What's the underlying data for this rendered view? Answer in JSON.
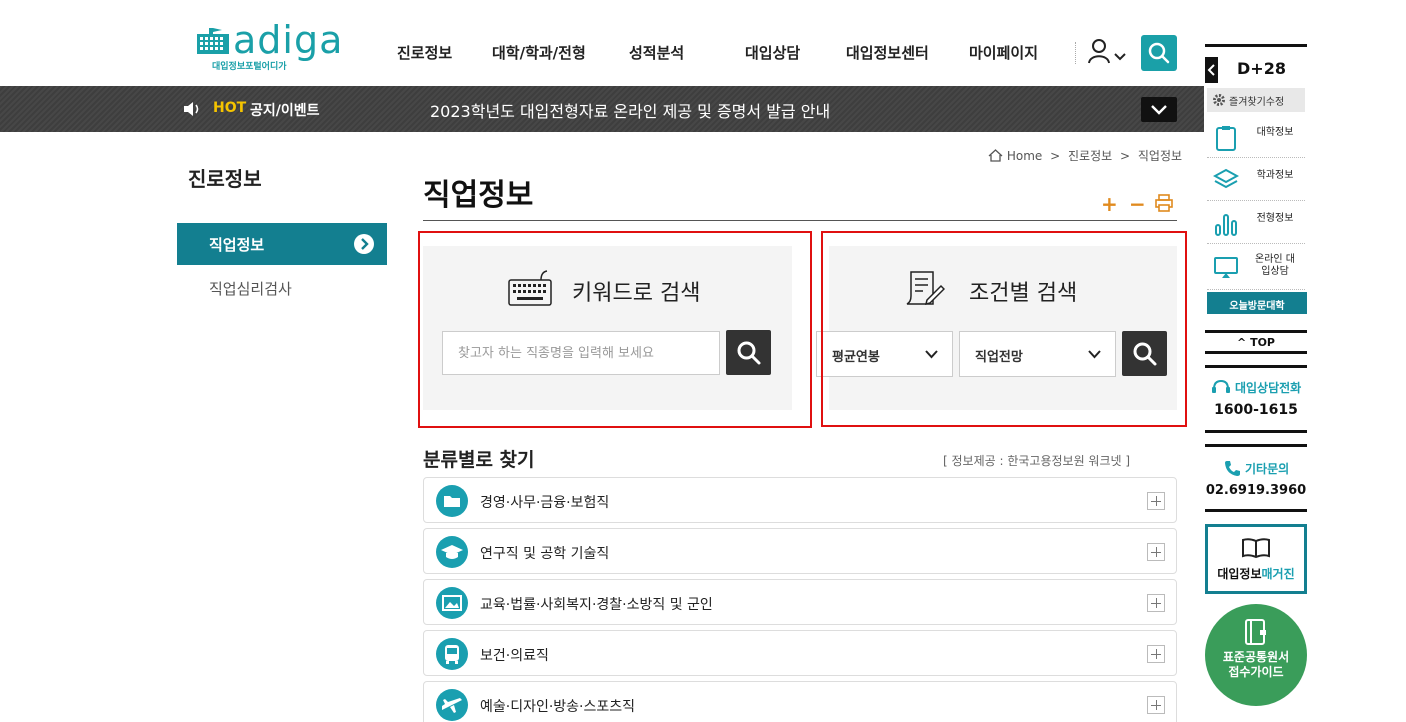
{
  "header": {
    "logo_text": "adiga",
    "logo_sub": "대입정보포털어디가",
    "nav": [
      "진로정보",
      "대학/학과/전형",
      "성적분석",
      "대입상담",
      "대입정보센터",
      "마이페이지"
    ]
  },
  "hotbar": {
    "hot_label": "HOT",
    "title": "공지/이벤트",
    "notice": "2023학년도 대입전형자료 온라인 제공 및 증명서 발급 안내"
  },
  "sidebar": {
    "title": "진로정보",
    "items": [
      "직업정보",
      "직업심리검사"
    ]
  },
  "breadcrumb": {
    "home": "Home",
    "sep": ">",
    "level1": "진로정보",
    "level2": "직업정보"
  },
  "main": {
    "title": "직업정보",
    "tools": {
      "plus": "+",
      "minus": "−"
    },
    "keyword_search": {
      "heading": "키워드로 검색",
      "placeholder": "찾고자 하는 직종명을 입력해 보세요"
    },
    "condition_search": {
      "heading": "조건별 검색",
      "select1": "평균연봉",
      "select2": "직업전망"
    },
    "category_title": "분류별로 찾기",
    "provider": "[ 정보제공 : 한국고용정보원 워크넷 ]",
    "categories": [
      "경영·사무·금융·보험직",
      "연구직 및 공학 기술직",
      "교육·법률·사회복지·경찰·소방직 및 군인",
      "보건·의료직",
      "예술·디자인·방송·스포츠직"
    ]
  },
  "quickmenu": {
    "dday": "D+28",
    "fav_edit": "즐겨찾기수정",
    "items": [
      "대학정보",
      "학과정보",
      "전형정보",
      "온라인 대입상담"
    ],
    "today_visit": "오늘방문대학",
    "top": "TOP",
    "consult_label": "대입상담전화",
    "consult_number": "1600-1615",
    "etc_label": "기타문의",
    "etc_number": "02.6919.3960",
    "magazine_a": "대입정보",
    "magazine_b": "매거진",
    "guide_line1": "표준공통원서",
    "guide_line2": "접수가이드"
  },
  "colors": {
    "brand": "#1aa0a8",
    "sidebar_active": "#137f90",
    "highlight_box": "#e01010",
    "hot": "#f5c400",
    "guide": "#3a9d5a"
  }
}
